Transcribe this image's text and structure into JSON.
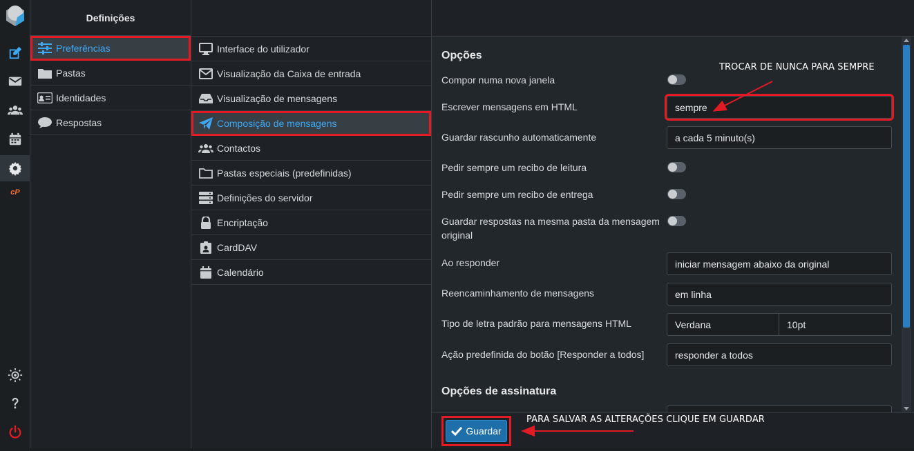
{
  "rail": {
    "items": [
      {
        "icon": "compose-icon",
        "color": "#3fa9f5"
      },
      {
        "icon": "mail-icon",
        "color": "#c9cdd0"
      },
      {
        "icon": "contacts-icon",
        "color": "#c9cdd0"
      },
      {
        "icon": "calendar-icon",
        "color": "#c9cdd0"
      },
      {
        "icon": "settings-gear-icon",
        "color": "#c9cdd0"
      },
      {
        "icon": "cpanel-icon",
        "color": "#ff6c2c"
      },
      {
        "icon": "theme-toggle-icon",
        "color": "#c9cdd0"
      },
      {
        "icon": "help-icon",
        "color": "#c9cdd0"
      },
      {
        "icon": "logout-icon",
        "color": "#e01b24"
      }
    ],
    "cpanel_text": "cP"
  },
  "settings": {
    "title": "Definições",
    "items": [
      {
        "label": "Preferências",
        "icon": "sliders-icon"
      },
      {
        "label": "Pastas",
        "icon": "folder-icon"
      },
      {
        "label": "Identidades",
        "icon": "id-card-icon"
      },
      {
        "label": "Respostas",
        "icon": "chat-bubble-icon"
      }
    ]
  },
  "sections": {
    "items": [
      {
        "label": "Interface do utilizador",
        "icon": "monitor-icon"
      },
      {
        "label": "Visualização da Caixa de entrada",
        "icon": "envelope-icon"
      },
      {
        "label": "Visualização de mensagens",
        "icon": "inbox-tray-icon"
      },
      {
        "label": "Composição de mensagens",
        "icon": "paper-plane-icon"
      },
      {
        "label": "Contactos",
        "icon": "users-icon"
      },
      {
        "label": "Pastas especiais (predefinidas)",
        "icon": "folder-outline-icon"
      },
      {
        "label": "Definições do servidor",
        "icon": "server-icon"
      },
      {
        "label": "Encriptação",
        "icon": "lock-icon"
      },
      {
        "label": "CardDAV",
        "icon": "address-card-icon"
      },
      {
        "label": "Calendário",
        "icon": "calendar-icon"
      }
    ]
  },
  "options": {
    "title": "Opções",
    "compose_new_window": "Compor numa nova janela",
    "html_compose": "Escrever mensagens em HTML",
    "html_compose_value": "sempre",
    "autosave": "Guardar rascunho automaticamente",
    "autosave_value": "a cada 5 minuto(s)",
    "read_receipt": "Pedir sempre um recibo de leitura",
    "delivery_receipt": "Pedir sempre um recibo de entrega",
    "reply_same_folder": "Guardar respostas na mesma pasta da mensagem original",
    "reply_mode": "Ao responder",
    "reply_mode_value": "iniciar mensagem abaixo da original",
    "forward": "Reencaminhamento de mensagens",
    "forward_value": "em linha",
    "font": "Tipo de letra padrão para mensagens HTML",
    "font_value": "Verdana",
    "font_size_value": "10pt",
    "reply_all": "Ação predefinida do botão [Responder a todos]",
    "reply_all_value": "responder a todos"
  },
  "signature": {
    "title": "Opções de assinatura"
  },
  "footer": {
    "save_label": "Guardar"
  },
  "annotations": {
    "top": "TROCAR DE  NUNCA PARA SEMPRE",
    "bottom": "PARA SALVAR AS ALTERAÇÕES CLIQUE EM GUARDAR",
    "color": "#e01b24"
  }
}
